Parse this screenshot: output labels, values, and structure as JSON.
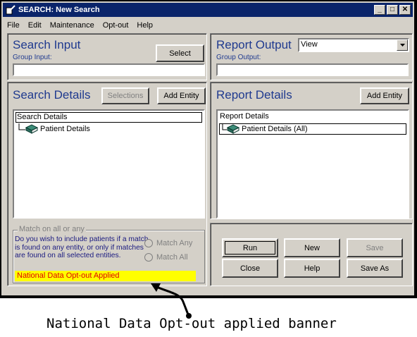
{
  "window": {
    "title": "SEARCH: New Search",
    "controls": {
      "minimize": "_",
      "maximize": "□",
      "close": "✕"
    }
  },
  "menu": [
    "File",
    "Edit",
    "Maintenance",
    "Opt-out",
    "Help"
  ],
  "search_input": {
    "heading": "Search Input",
    "sublabel": "Group Input:",
    "value": "",
    "select_label": "Select"
  },
  "report_output": {
    "heading": "Report Output",
    "sublabel": "Group Output:",
    "dropdown_value": "View",
    "value": ""
  },
  "search_details": {
    "heading": "Search Details",
    "selections_label": "Selections",
    "add_entity_label": "Add Entity",
    "tree_root": "Search Details",
    "tree_child": "Patient Details"
  },
  "report_details": {
    "heading": "Report Details",
    "add_entity_label": "Add Entity",
    "tree_root": "Report Details",
    "tree_child": "Patient Details (All)"
  },
  "match": {
    "legend": "Match on all or any",
    "description": "Do you wish to include patients if a match is found on any entity, or only if matches are found on all selected entities.",
    "option_any": "Match Any",
    "option_all": "Match All",
    "banner": "National Data Opt-out Applied"
  },
  "actions": {
    "run": "Run",
    "new": "New",
    "save": "Save",
    "close": "Close",
    "help": "Help",
    "save_as": "Save As"
  },
  "annotation": {
    "caption": "National Data Opt-out applied banner"
  },
  "colors": {
    "titlebar": "#0a246a",
    "heading": "#1f3a8f",
    "banner_bg": "#ffff00",
    "banner_text": "#e00000"
  }
}
